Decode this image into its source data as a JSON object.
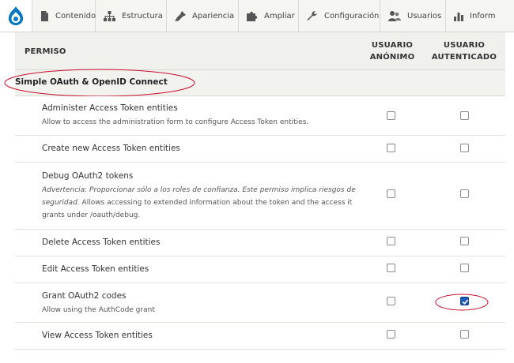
{
  "toolbar": {
    "items": [
      {
        "label": "Contenido",
        "icon": "file-icon"
      },
      {
        "label": "Estructura",
        "icon": "sitemap-icon"
      },
      {
        "label": "Apariencia",
        "icon": "paintbrush-icon"
      },
      {
        "label": "Ampliar",
        "icon": "puzzle-icon"
      },
      {
        "label": "Configuración",
        "icon": "wrench-icon"
      },
      {
        "label": "Usuarios",
        "icon": "people-icon"
      },
      {
        "label": "Inform",
        "icon": "bar-chart-icon"
      }
    ]
  },
  "table": {
    "headers": {
      "permission": "PERMISO",
      "anon_line1": "USUARIO",
      "anon_line2": "ANÓNIMO",
      "auth_line1": "USUARIO",
      "auth_line2": "AUTENTICADO"
    },
    "module": "Simple OAuth & OpenID Connect",
    "rows": [
      {
        "title": "Administer Access Token entities",
        "desc": "Allow to access the administration form to configure Access Token entities.",
        "anon": false,
        "auth": false
      },
      {
        "title": "Create new Access Token entities",
        "anon": false,
        "auth": false
      },
      {
        "title": "Debug OAuth2 tokens",
        "warning": "Advertencia: Proporcionar sólo a los roles de confianza. Este permiso implica riesgos de seguridad.",
        "desc": "Allows accessing to extended information about the token and the access it grants under /oauth/debug.",
        "anon": false,
        "auth": false
      },
      {
        "title": "Delete Access Token entities",
        "anon": false,
        "auth": false
      },
      {
        "title": "Edit Access Token entities",
        "anon": false,
        "auth": false
      },
      {
        "title": "Grant OAuth2 codes",
        "desc": "Allow using the AuthCode grant",
        "anon": false,
        "auth": true
      },
      {
        "title": "View Access Token entities",
        "anon": false,
        "auth": false
      }
    ]
  },
  "colors": {
    "accent": "#1a5ab8",
    "annotation": "#c8102e",
    "drupal_blue": "#0678be"
  }
}
